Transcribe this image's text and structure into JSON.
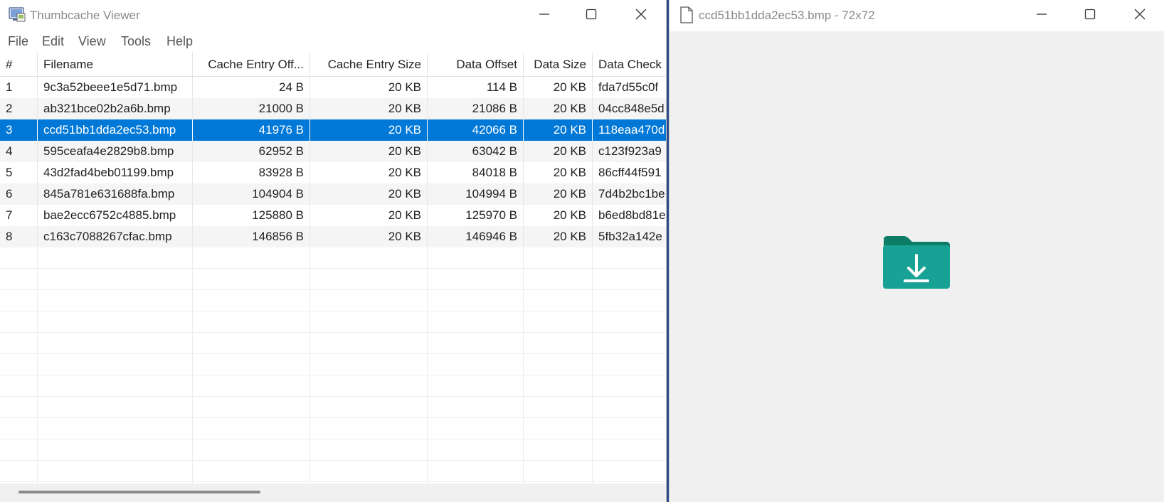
{
  "main_window": {
    "title": "Thumbcache Viewer",
    "menu": [
      "File",
      "Edit",
      "View",
      "Tools",
      "Help"
    ],
    "columns": [
      "#",
      "Filename",
      "Cache Entry Off...",
      "Cache Entry Size",
      "Data Offset",
      "Data Size",
      "Data Check"
    ],
    "rows": [
      [
        "1",
        "9c3a52beee1e5d71.bmp",
        "24 B",
        "20 KB",
        "114 B",
        "20 KB",
        "fda7d55c0f"
      ],
      [
        "2",
        "ab321bce02b2a6b.bmp",
        "21000 B",
        "20 KB",
        "21086 B",
        "20 KB",
        "04cc848e5d"
      ],
      [
        "3",
        "ccd51bb1dda2ec53.bmp",
        "41976 B",
        "20 KB",
        "42066 B",
        "20 KB",
        "118eaa470d"
      ],
      [
        "4",
        "595ceafa4e2829b8.bmp",
        "62952 B",
        "20 KB",
        "63042 B",
        "20 KB",
        "c123f923a9"
      ],
      [
        "5",
        "43d2fad4beb01199.bmp",
        "83928 B",
        "20 KB",
        "84018 B",
        "20 KB",
        "86cff44f591"
      ],
      [
        "6",
        "845a781e631688fa.bmp",
        "104904 B",
        "20 KB",
        "104994 B",
        "20 KB",
        "7d4b2bc1be"
      ],
      [
        "7",
        "bae2ecc6752c4885.bmp",
        "125880 B",
        "20 KB",
        "125970 B",
        "20 KB",
        "b6ed8bd81e"
      ],
      [
        "8",
        "c163c7088267cfac.bmp",
        "146856 B",
        "20 KB",
        "146946 B",
        "20 KB",
        "5fb32a142e"
      ]
    ],
    "selected_row": 2
  },
  "preview_window": {
    "title": "ccd51bb1dda2ec53.bmp - 72x72",
    "image_icon": "folder-download-icon"
  },
  "colors": {
    "selection": "#0078d7",
    "folder_teal": "#1aa79a",
    "folder_tab": "#0e7d68"
  },
  "icons": [
    "app-icon",
    "file-icon",
    "minimize-icon",
    "maximize-icon",
    "close-icon",
    "folder-download-icon"
  ]
}
